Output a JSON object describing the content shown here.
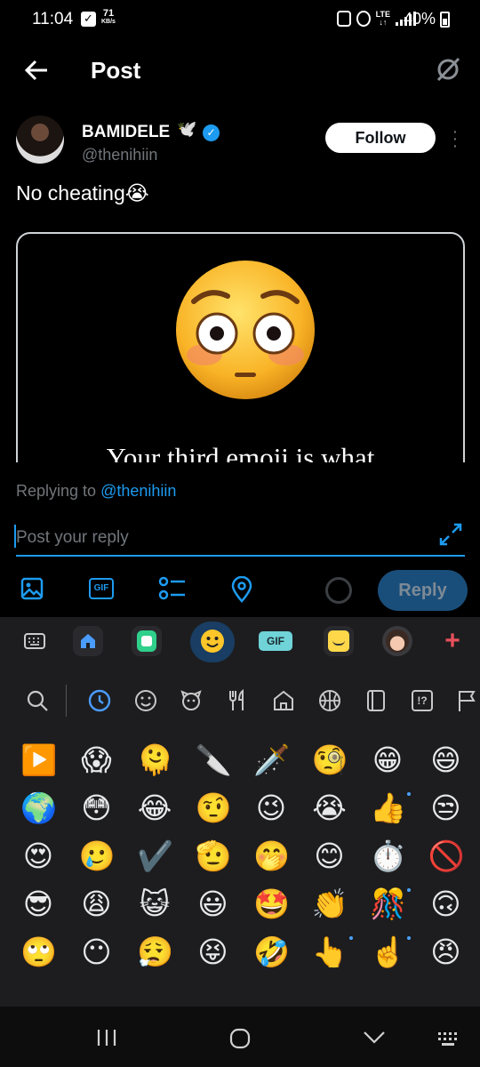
{
  "status_bar": {
    "time": "11:04",
    "net_speed": "71",
    "net_unit": "KB/s",
    "lte": "LTE",
    "battery": "40%"
  },
  "header": {
    "title": "Post"
  },
  "tweet": {
    "author_name": "BAMIDELE",
    "author_emoji": "🕊️",
    "handle": "@thenihiin",
    "follow_label": "Follow",
    "text": "No cheating😭",
    "media_caption": "Your third emoji is what"
  },
  "composer": {
    "replying_prefix": "Replying to ",
    "replying_handle": "@thenihiin",
    "placeholder": "Post your reply",
    "reply_label": "Reply",
    "gif_label": "GIF"
  },
  "keyboard": {
    "toolbar_gif_label": "GIF",
    "emoji_rows": [
      [
        "▶️",
        "😱",
        "🫠",
        "🔪",
        "🗡️",
        "🧐",
        "😁",
        "😄"
      ],
      [
        "🌍",
        "😳",
        "😂",
        "🤨",
        "😉",
        "😭",
        "👍",
        "😒"
      ],
      [
        "😍",
        "🥲",
        "✔️",
        "🫡",
        "🤭",
        "😊",
        "⏱️",
        "🚫"
      ],
      [
        "😎",
        "😩",
        "😺",
        "😃",
        "🤩",
        "👏",
        "🎊",
        "🙃"
      ],
      [
        "🙄",
        "😶",
        "😮‍💨",
        "😝",
        "🤣",
        "👆",
        "☝️",
        "😠"
      ]
    ]
  },
  "colors": {
    "accent": "#1d9bf0",
    "background": "#000000",
    "keyboard_bg": "#1d1d1f"
  }
}
